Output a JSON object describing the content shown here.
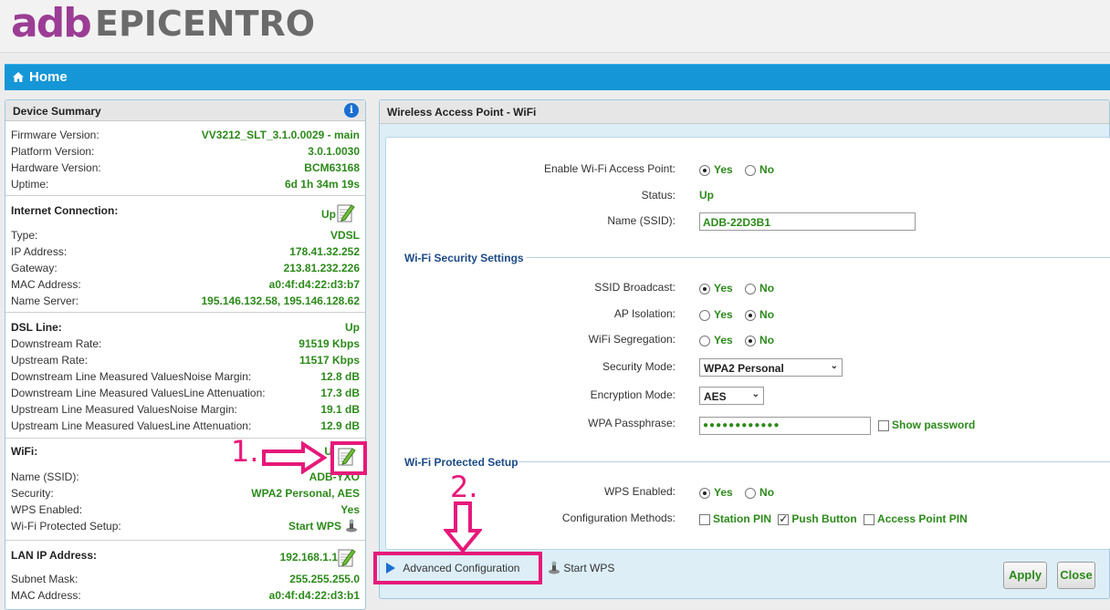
{
  "header": {
    "logo_adb": "adb",
    "logo_brand": "EPICENTRO"
  },
  "nav": {
    "home_title": "Home"
  },
  "summary": {
    "title": "Device Summary",
    "info_icon_glyph": "i",
    "firmware": {
      "label": "Firmware Version:",
      "value": "VV3212_SLT_3.1.0.0029 - main"
    },
    "platform": {
      "label": "Platform Version:",
      "value": "3.0.1.0030"
    },
    "hardware": {
      "label": "Hardware Version:",
      "value": "BCM63168"
    },
    "uptime": {
      "label": "Uptime:",
      "value": "6d 1h 34m 19s"
    },
    "internet": {
      "label": "Internet Connection:",
      "status": "Up",
      "type": {
        "label": "Type:",
        "value": "VDSL"
      },
      "ip": {
        "label": "IP Address:",
        "value": "178.41.32.252"
      },
      "gateway": {
        "label": "Gateway:",
        "value": "213.81.232.226"
      },
      "mac": {
        "label": "MAC Address:",
        "value": "a0:4f:d4:22:d3:b7"
      },
      "dns": {
        "label": "Name Server:",
        "value": "195.146.132.58, 195.146.128.62"
      }
    },
    "dsl": {
      "label": "DSL Line:",
      "status": "Up",
      "down_rate": {
        "label": "Downstream Rate:",
        "value": "91519 Kbps"
      },
      "up_rate": {
        "label": "Upstream Rate:",
        "value": "11517 Kbps"
      },
      "down_noise": {
        "label": "Downstream Line Measured ValuesNoise Margin:",
        "value": "12.8 dB"
      },
      "down_atten": {
        "label": "Downstream Line Measured ValuesLine Attenuation:",
        "value": "17.3 dB"
      },
      "up_noise": {
        "label": "Upstream Line Measured ValuesNoise Margin:",
        "value": "19.1 dB"
      },
      "up_atten": {
        "label": "Upstream Line Measured ValuesLine Attenuation:",
        "value": "12.9 dB"
      }
    },
    "wifi": {
      "label": "WiFi:",
      "status_partial": "U",
      "ssid": {
        "label": "Name (SSID):",
        "value": "ADB-YXO"
      },
      "security": {
        "label": "Security:",
        "value": "WPA2 Personal, AES"
      },
      "wps": {
        "label": "WPS Enabled:",
        "value": "Yes"
      },
      "wps_setup": {
        "label": "Wi-Fi Protected Setup:",
        "value": "Start WPS"
      }
    },
    "lan": {
      "label": "LAN IP Address:",
      "value": "192.168.1.1",
      "mask": {
        "label": "Subnet Mask:",
        "value": "255.255.255.0"
      },
      "mac": {
        "label": "MAC Address:",
        "value": "a0:4f:d4:22:d3:b1"
      }
    }
  },
  "wifi_panel": {
    "title": "Wireless Access Point - WiFi",
    "enable": {
      "label": "Enable Wi-Fi Access Point:",
      "yes": "Yes",
      "no": "No",
      "selected": "Yes"
    },
    "status": {
      "label": "Status:",
      "value": "Up"
    },
    "ssid": {
      "label": "Name (SSID):",
      "value": "ADB-22D3B1"
    },
    "security_section": "Wi-Fi Security Settings",
    "broadcast": {
      "label": "SSID Broadcast:",
      "yes": "Yes",
      "no": "No",
      "selected": "Yes"
    },
    "isolation": {
      "label": "AP Isolation:",
      "yes": "Yes",
      "no": "No",
      "selected": "No"
    },
    "segregation": {
      "label": "WiFi Segregation:",
      "yes": "Yes",
      "no": "No",
      "selected": "No"
    },
    "security_mode": {
      "label": "Security Mode:",
      "value": "WPA2 Personal"
    },
    "encryption": {
      "label": "Encryption Mode:",
      "value": "AES"
    },
    "passphrase": {
      "label": "WPA Passphrase:",
      "value": "●●●●●●●●●●●●",
      "show_label": "Show password",
      "show_checked": false
    },
    "wps_section": "Wi-Fi Protected Setup",
    "wps_enabled": {
      "label": "WPS Enabled:",
      "yes": "Yes",
      "no": "No",
      "selected": "Yes"
    },
    "config_methods": {
      "label": "Configuration Methods:",
      "station_pin": "Station PIN",
      "station_pin_checked": false,
      "push_button": "Push Button",
      "push_button_checked": true,
      "ap_pin": "Access Point PIN",
      "ap_pin_checked": false
    },
    "advanced_label": "Advanced Configuration",
    "start_wps_label": "Start WPS",
    "apply_label": "Apply",
    "close_label": "Close"
  },
  "annotations": {
    "step1": "1.",
    "step2": "2.",
    "accent_color": "#e6197a"
  },
  "colors": {
    "accent_blue": "#1596d6",
    "value_green": "#2c8a1a",
    "section_blue": "#1c4a86"
  }
}
